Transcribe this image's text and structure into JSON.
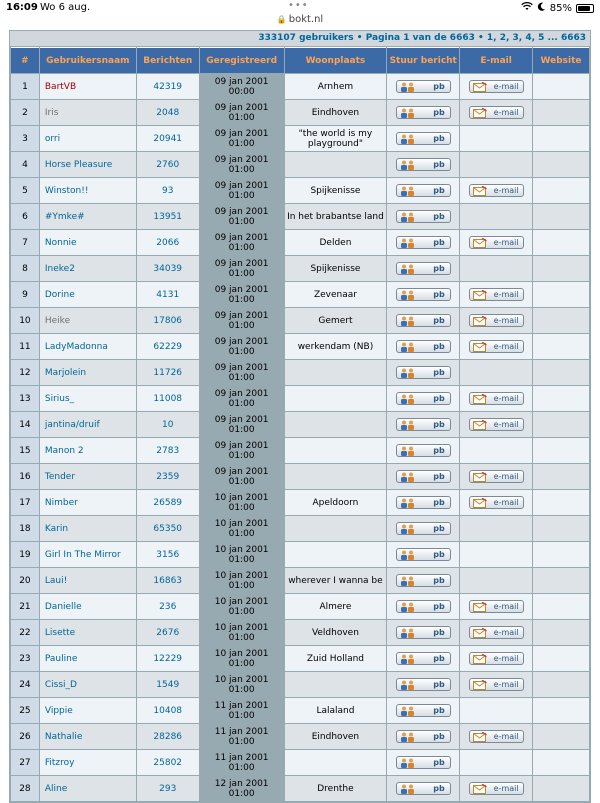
{
  "status": {
    "time": "16:09",
    "date": "Wo 6 aug.",
    "battery": "85%"
  },
  "url": "bokt.nl",
  "topbar": {
    "count": "333107 gebruikers",
    "pager": "Pagina 1 van de 6663",
    "pages": "1, 2, 3, 4, 5 ... 6663"
  },
  "headers": [
    "#",
    "Gebruikersnaam",
    "Berichten",
    "Geregistreerd",
    "Woonplaats",
    "Stuur bericht",
    "E-mail",
    "Website"
  ],
  "pb_label": "pb",
  "mail_label": "e-mail",
  "rows": [
    {
      "n": "1",
      "name": "BartVB",
      "posts": "42319",
      "reg1": "09 jan 2001",
      "reg2": "00:00",
      "place": "Arnhem",
      "mail": true,
      "style": "special"
    },
    {
      "n": "2",
      "name": "Iris",
      "posts": "2048",
      "reg1": "09 jan 2001",
      "reg2": "01:00",
      "place": "Eindhoven",
      "mail": true,
      "style": "grey"
    },
    {
      "n": "3",
      "name": "orri",
      "posts": "20941",
      "reg1": "09 jan 2001",
      "reg2": "01:00",
      "place": "\"the world is my playground\"",
      "mail": false,
      "style": ""
    },
    {
      "n": "4",
      "name": "Horse Pleasure",
      "posts": "2760",
      "reg1": "09 jan 2001",
      "reg2": "01:00",
      "place": "",
      "mail": false,
      "style": ""
    },
    {
      "n": "5",
      "name": "Winston!!",
      "posts": "93",
      "reg1": "09 jan 2001",
      "reg2": "01:00",
      "place": "Spijkenisse",
      "mail": true,
      "style": ""
    },
    {
      "n": "6",
      "name": "#Ymke#",
      "posts": "13951",
      "reg1": "09 jan 2001",
      "reg2": "01:00",
      "place": "In het brabantse land",
      "mail": false,
      "style": ""
    },
    {
      "n": "7",
      "name": "Nonnie",
      "posts": "2066",
      "reg1": "09 jan 2001",
      "reg2": "01:00",
      "place": "Delden",
      "mail": true,
      "style": ""
    },
    {
      "n": "8",
      "name": "Ineke2",
      "posts": "34039",
      "reg1": "09 jan 2001",
      "reg2": "01:00",
      "place": "Spijkenisse",
      "mail": false,
      "style": ""
    },
    {
      "n": "9",
      "name": "Dorine",
      "posts": "4131",
      "reg1": "09 jan 2001",
      "reg2": "01:00",
      "place": "Zevenaar",
      "mail": true,
      "style": ""
    },
    {
      "n": "10",
      "name": "Heike",
      "posts": "17806",
      "reg1": "09 jan 2001",
      "reg2": "01:00",
      "place": "Gemert",
      "mail": true,
      "style": "grey"
    },
    {
      "n": "11",
      "name": "LadyMadonna",
      "posts": "62229",
      "reg1": "09 jan 2001",
      "reg2": "01:00",
      "place": "werkendam (NB)",
      "mail": true,
      "style": ""
    },
    {
      "n": "12",
      "name": "Marjolein",
      "posts": "11726",
      "reg1": "09 jan 2001",
      "reg2": "01:00",
      "place": "",
      "mail": false,
      "style": ""
    },
    {
      "n": "13",
      "name": "Sirius_",
      "posts": "11008",
      "reg1": "09 jan 2001",
      "reg2": "01:00",
      "place": "",
      "mail": true,
      "style": ""
    },
    {
      "n": "14",
      "name": "jantina/druif",
      "posts": "10",
      "reg1": "09 jan 2001",
      "reg2": "01:00",
      "place": "",
      "mail": true,
      "style": ""
    },
    {
      "n": "15",
      "name": "Manon 2",
      "posts": "2783",
      "reg1": "09 jan 2001",
      "reg2": "01:00",
      "place": "",
      "mail": false,
      "style": ""
    },
    {
      "n": "16",
      "name": "Tender",
      "posts": "2359",
      "reg1": "09 jan 2001",
      "reg2": "01:00",
      "place": "",
      "mail": true,
      "style": ""
    },
    {
      "n": "17",
      "name": "Nimber",
      "posts": "26589",
      "reg1": "10 jan 2001",
      "reg2": "01:00",
      "place": "Apeldoorn",
      "mail": true,
      "style": ""
    },
    {
      "n": "18",
      "name": "Karin",
      "posts": "65350",
      "reg1": "10 jan 2001",
      "reg2": "01:00",
      "place": "",
      "mail": false,
      "style": ""
    },
    {
      "n": "19",
      "name": "Girl In The Mirror",
      "posts": "3156",
      "reg1": "10 jan 2001",
      "reg2": "01:00",
      "place": "",
      "mail": false,
      "style": ""
    },
    {
      "n": "20",
      "name": "Laui!",
      "posts": "16863",
      "reg1": "10 jan 2001",
      "reg2": "01:00",
      "place": "wherever I wanna be",
      "mail": false,
      "style": ""
    },
    {
      "n": "21",
      "name": "Danielle",
      "posts": "236",
      "reg1": "10 jan 2001",
      "reg2": "01:00",
      "place": "Almere",
      "mail": true,
      "style": ""
    },
    {
      "n": "22",
      "name": "Lisette",
      "posts": "2676",
      "reg1": "10 jan 2001",
      "reg2": "01:00",
      "place": "Veldhoven",
      "mail": true,
      "style": ""
    },
    {
      "n": "23",
      "name": "Pauline",
      "posts": "12229",
      "reg1": "10 jan 2001",
      "reg2": "01:00",
      "place": "Zuid Holland",
      "mail": true,
      "style": ""
    },
    {
      "n": "24",
      "name": "Cissi_D",
      "posts": "1549",
      "reg1": "10 jan 2001",
      "reg2": "01:00",
      "place": "",
      "mail": true,
      "style": ""
    },
    {
      "n": "25",
      "name": "Vippie",
      "posts": "10408",
      "reg1": "11 jan 2001",
      "reg2": "01:00",
      "place": "Lalaland",
      "mail": false,
      "style": ""
    },
    {
      "n": "26",
      "name": "Nathalie",
      "posts": "28286",
      "reg1": "11 jan 2001",
      "reg2": "01:00",
      "place": "Eindhoven",
      "mail": true,
      "style": ""
    },
    {
      "n": "27",
      "name": "Fitzroy",
      "posts": "25802",
      "reg1": "11 jan 2001",
      "reg2": "01:00",
      "place": "",
      "mail": false,
      "style": ""
    },
    {
      "n": "28",
      "name": "Aline",
      "posts": "293",
      "reg1": "12 jan 2001",
      "reg2": "01:00",
      "place": "Drenthe",
      "mail": true,
      "style": ""
    }
  ],
  "colors": {
    "header_bg": "#3b6aa6",
    "header_text": "#ffa34f",
    "link": "#006699",
    "row_light": "#eef3f7",
    "row_dark": "#dee3e7"
  }
}
